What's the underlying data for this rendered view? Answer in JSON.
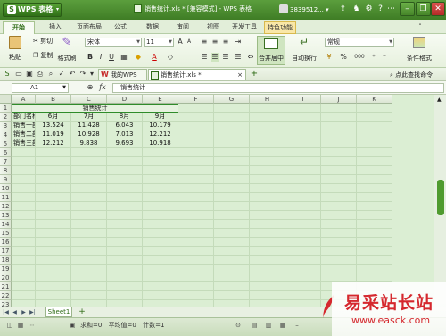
{
  "titlebar": {
    "app_label": "WPS 表格",
    "doc_title": "销售统计.xls * [兼容模式] - WPS 表格",
    "user": "3839512...",
    "icons": [
      "user-avatar",
      "dropdown",
      "upload",
      "clothes",
      "skin",
      "help",
      "help-menu",
      "minimize",
      "restore",
      "close"
    ]
  },
  "tabs": [
    "开始",
    "插入",
    "页面布局",
    "公式",
    "数据",
    "审阅",
    "视图",
    "开发工具",
    "特色功能"
  ],
  "active_tab": "开始",
  "ribbon": {
    "paste": "粘贴",
    "cut": "剪切",
    "copy": "复制",
    "format_painter": "格式刷",
    "font": "宋体",
    "font_size": "11",
    "bold": "B",
    "italic": "I",
    "underline": "U",
    "merge": "合并居中",
    "wrap": "自动换行",
    "number_format": "常规",
    "percent": "%",
    "cond_format": "条件格式",
    "comma": "000"
  },
  "quickbar": {
    "doc_tabs": [
      "我的WPS",
      "销售统计.xls *"
    ],
    "add": "+",
    "recommend": "点此查找命令"
  },
  "formula_bar": {
    "name_box": "A1",
    "fx": "fx",
    "content": "销售统计"
  },
  "columns": [
    "A",
    "B",
    "C",
    "D",
    "E",
    "F",
    "G",
    "H",
    "I",
    "J",
    "K"
  ],
  "rows": [
    "1",
    "2",
    "3",
    "4",
    "5",
    "6",
    "7",
    "8",
    "9",
    "10",
    "11",
    "12",
    "13",
    "14",
    "15",
    "16",
    "17",
    "18",
    "19",
    "20",
    "21",
    "22",
    "23"
  ],
  "table": {
    "title": "销售统计",
    "header": [
      "部门名称",
      "6月",
      "7月",
      "8月",
      "9月"
    ],
    "data": [
      [
        "销售一部",
        "13.524",
        "11.428",
        "6.043",
        "10.179"
      ],
      [
        "销售二部",
        "11.019",
        "10.928",
        "7.013",
        "12.212"
      ],
      [
        "销售三部",
        "12.212",
        "9.838",
        "9.693",
        "10.918"
      ]
    ]
  },
  "sheets": [
    "Sheet1"
  ],
  "status": {
    "sum": "求和=0",
    "avg": "平均值=0",
    "count": "计数=1"
  },
  "watermark": {
    "title": "易采站长站",
    "url": "www.easck.com"
  },
  "colors": {
    "title_green": "#3f7d25",
    "grid_bg": "#dbeed3",
    "accent": "#2e6b15",
    "watermark_red": "#d5282e"
  }
}
